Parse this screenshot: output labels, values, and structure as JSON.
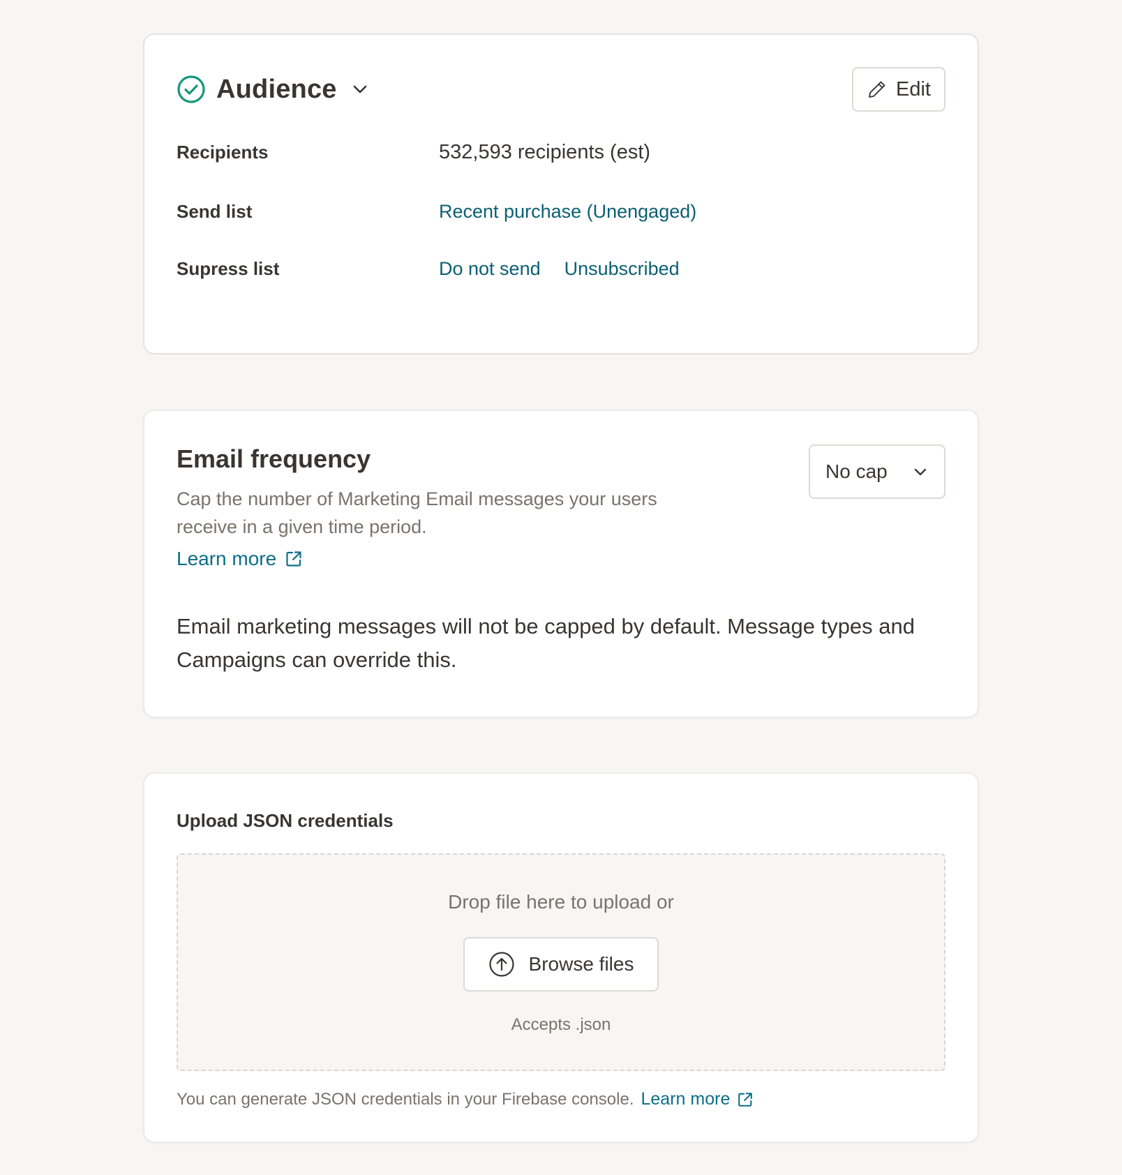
{
  "audience": {
    "title": "Audience",
    "edit_label": "Edit",
    "rows": {
      "recipients": {
        "label": "Recipients",
        "value": "532,593 recipients (est)"
      },
      "send_list": {
        "label": "Send list",
        "links": [
          "Recent purchase (Unengaged)"
        ]
      },
      "supress_list": {
        "label": "Supress list",
        "links": [
          "Do not send",
          "Unsubscribed"
        ]
      }
    }
  },
  "email_frequency": {
    "title": "Email frequency",
    "description": "Cap the number of Marketing Email messages your users receive in a given time period.",
    "learn_more": "Learn more",
    "select_value": "No cap",
    "note": "Email marketing messages will not be capped by default. Message types and Campaigns can override this."
  },
  "upload": {
    "title": "Upload JSON credentials",
    "drop_text": "Drop file here to upload or",
    "browse_label": "Browse files",
    "accepts": "Accepts .json",
    "footer_text": "You can generate JSON credentials in your Firebase console.",
    "footer_link": "Learn more"
  },
  "colors": {
    "background": "#f7f6f4",
    "link": "#0b5f73",
    "success": "#16957a",
    "text": "#3a3531",
    "muted": "#7a736c"
  },
  "icons": [
    "check-circle-icon",
    "chevron-down-icon",
    "pencil-icon",
    "external-link-icon",
    "upload-arrow-icon"
  ]
}
